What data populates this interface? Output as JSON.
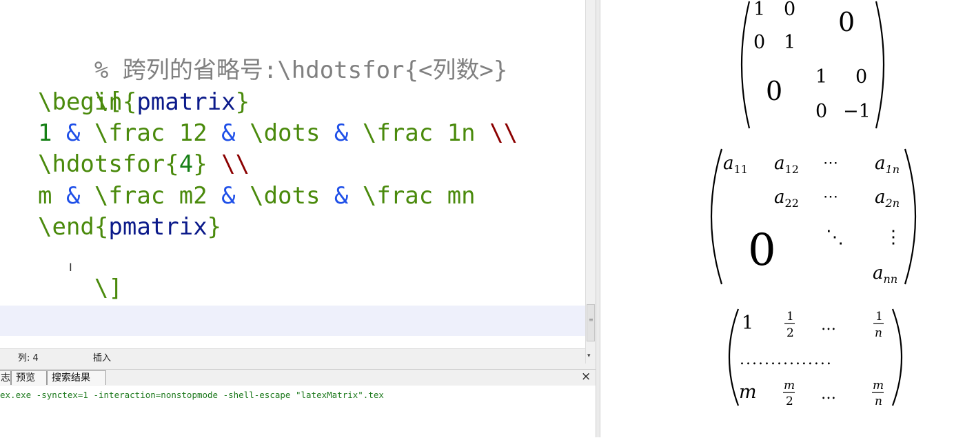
{
  "editor": {
    "lines": [
      {
        "parts": [
          "% 跨列的省略号:\\hdotsfor{<列数>}"
        ]
      },
      {
        "parts": [
          "\\["
        ]
      },
      {
        "parts": [
          "\\begin",
          "{",
          "pmatrix",
          "}"
        ]
      },
      {
        "parts": [
          "1 ",
          "&",
          " \\frac 12 ",
          "&",
          " \\dots ",
          "&",
          " \\frac 1n ",
          "\\\\"
        ]
      },
      {
        "parts": [
          "\\hdotsfor",
          "{",
          "4",
          "}",
          " \\\\"
        ]
      },
      {
        "parts": [
          "m ",
          "&",
          " \\frac m2 ",
          "&",
          " \\dots ",
          "&",
          " \\frac mn"
        ]
      },
      {
        "parts": [
          "\\end",
          "{",
          "pmatrix",
          "}"
        ]
      },
      {
        "parts": [
          "\\]"
        ]
      }
    ],
    "cursor_glyph": "I"
  },
  "status_bar": {
    "column": "列:  4",
    "mode": "插入"
  },
  "bottom_panel": {
    "tabs": [
      "志",
      "预览",
      "搜索结果"
    ],
    "close_glyph": "×",
    "command": "ex.exe -synctex=1 -interaction=nonstopmode -shell-escape \"latexMatrix\".tex"
  },
  "preview": {
    "matrix1": {
      "top_left": [
        [
          "1",
          "0"
        ],
        [
          "0",
          "1"
        ]
      ],
      "top_right_zero": "0",
      "bottom_left_zero": "0",
      "bottom_right": [
        [
          "1",
          "0"
        ],
        [
          "0",
          "−1"
        ]
      ]
    },
    "matrix2": {
      "row1": [
        [
          "a",
          "11"
        ],
        [
          "a",
          "12"
        ],
        [
          "⋯",
          ""
        ],
        [
          "a",
          "1n"
        ]
      ],
      "row2": [
        [
          "a",
          "22"
        ],
        [
          "⋯",
          ""
        ],
        [
          "a",
          "2n"
        ]
      ],
      "zero": "0",
      "ddots": "⋱",
      "vdots": "⋮",
      "ann": [
        "a",
        "nn"
      ]
    },
    "matrix3": {
      "row1": {
        "first": "1",
        "frac1": [
          "1",
          "2"
        ],
        "dots": "…",
        "frac2": [
          "1",
          "n"
        ]
      },
      "hdots": "...............",
      "row3": {
        "first": "m",
        "frac1": [
          "m",
          "2"
        ],
        "dots": "…",
        "frac2": [
          "m",
          "n"
        ]
      }
    }
  }
}
